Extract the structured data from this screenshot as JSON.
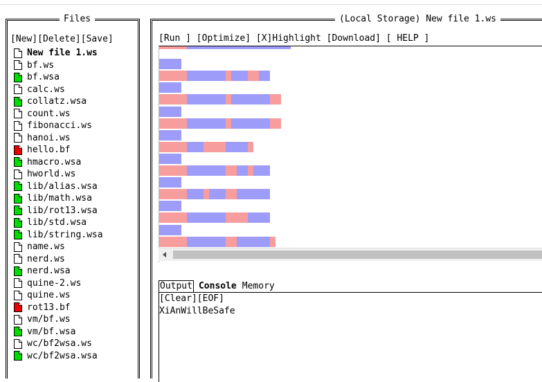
{
  "files_panel": {
    "title": "Files",
    "toolbar": {
      "new": "[New]",
      "delete": "[Delete]",
      "save": "[Save]"
    },
    "files": [
      {
        "name": "New file 1.ws",
        "icon": "file-blank-icon",
        "active": true
      },
      {
        "name": "bf.ws",
        "icon": "file-blank-icon"
      },
      {
        "name": "bf.wsa",
        "icon": "file-green-icon"
      },
      {
        "name": "calc.ws",
        "icon": "file-blank-icon"
      },
      {
        "name": "collatz.wsa",
        "icon": "file-green-icon"
      },
      {
        "name": "count.ws",
        "icon": "file-blank-icon"
      },
      {
        "name": "fibonacci.ws",
        "icon": "file-blank-icon"
      },
      {
        "name": "hanoi.ws",
        "icon": "file-blank-icon"
      },
      {
        "name": "hello.bf",
        "icon": "file-red-icon"
      },
      {
        "name": "hmacro.wsa",
        "icon": "file-green-icon"
      },
      {
        "name": "hworld.ws",
        "icon": "file-blank-icon"
      },
      {
        "name": "lib/alias.wsa",
        "icon": "file-green-icon"
      },
      {
        "name": "lib/math.wsa",
        "icon": "file-green-icon"
      },
      {
        "name": "lib/rot13.wsa",
        "icon": "file-green-icon"
      },
      {
        "name": "lib/std.wsa",
        "icon": "file-green-icon"
      },
      {
        "name": "lib/string.wsa",
        "icon": "file-green-icon"
      },
      {
        "name": "name.ws",
        "icon": "file-blank-icon"
      },
      {
        "name": "nerd.ws",
        "icon": "file-blank-icon"
      },
      {
        "name": "nerd.wsa",
        "icon": "file-green-icon"
      },
      {
        "name": "quine-2.ws",
        "icon": "file-blank-icon"
      },
      {
        "name": "quine.ws",
        "icon": "file-blank-icon"
      },
      {
        "name": "rot13.bf",
        "icon": "file-red-icon"
      },
      {
        "name": "vm/bf.ws",
        "icon": "file-blank-icon"
      },
      {
        "name": "vm/bf.wsa",
        "icon": "file-green-icon"
      },
      {
        "name": "wc/bf2wsa.ws",
        "icon": "file-blank-icon"
      },
      {
        "name": "wc/bf2wsa.wsa",
        "icon": "file-green-icon"
      }
    ]
  },
  "editor": {
    "title": "(Local Storage) New file 1.ws",
    "toolbar": {
      "run": "[Run ]",
      "optimize": "[Optimize]",
      "highlight": "[X]Highlight",
      "download": "[Download]",
      "help": "[ HELP ]"
    }
  },
  "output": {
    "tabs": {
      "output": "Output",
      "console": "Console",
      "memory": "Memory"
    },
    "toolbar": {
      "clear": "[Clear]",
      "eof": "[EOF]"
    },
    "text": "XiAnWillBeSafe"
  },
  "colors": {
    "space": "#9d9cf8",
    "tab": "#f89d9d",
    "icon_green": "#00dd00",
    "icon_red": "#ee0000"
  }
}
